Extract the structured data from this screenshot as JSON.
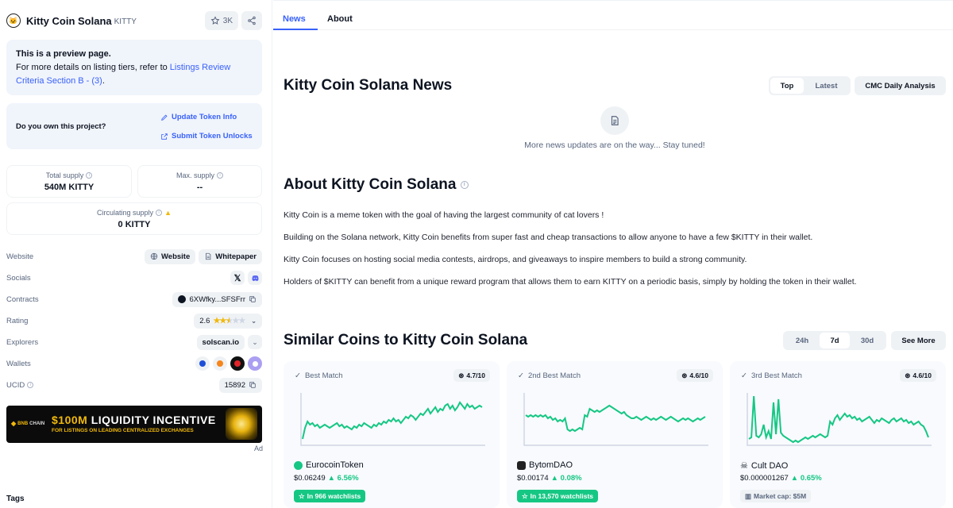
{
  "coin": {
    "name": "Kitty Coin Solana",
    "symbol": "KITTY",
    "star_count": "3K"
  },
  "preview": {
    "title": "This is a preview page.",
    "text": "For more details on listing tiers, refer to ",
    "link": "Listings Review Criteria Section B - (3)",
    "suffix": "."
  },
  "own": {
    "question": "Do you own this project?",
    "update_link": "Update Token Info",
    "unlocks_link": "Submit Token Unlocks"
  },
  "stats": {
    "total_supply_label": "Total supply",
    "total_supply_value": "540M KITTY",
    "max_supply_label": "Max. supply",
    "max_supply_value": "--",
    "circ_supply_label": "Circulating supply",
    "circ_supply_value": "0 KITTY"
  },
  "links": {
    "website_label": "Website",
    "website_btn": "Website",
    "whitepaper_btn": "Whitepaper",
    "socials_label": "Socials",
    "contracts_label": "Contracts",
    "contract_value": "6XWfky...SFSFrr",
    "rating_label": "Rating",
    "rating_value": "2.6",
    "rating_stars": 2.6,
    "explorers_label": "Explorers",
    "explorer_value": "solscan.io",
    "wallets_label": "Wallets",
    "ucid_label": "UCID",
    "ucid_value": "15892"
  },
  "banner": {
    "brand": "BNB",
    "brand_suffix": "CHAIN",
    "headline_amount": "$100M",
    "headline_text": " LIQUIDITY INCENTIVE",
    "subline": "FOR LISTINGS ON LEADING CENTRALIZED EXCHANGES",
    "ad_label": "Ad"
  },
  "tags_label": "Tags",
  "tabs": {
    "news": "News",
    "about": "About"
  },
  "news": {
    "title": "Kitty Coin Solana News",
    "filter_top": "Top",
    "filter_latest": "Latest",
    "analysis_btn": "CMC Daily Analysis",
    "empty": "More news updates are on the way... Stay tuned!"
  },
  "about": {
    "title": "About Kitty Coin Solana",
    "p1": "Kitty Coin is a meme token with the goal of having the largest community of cat lovers !",
    "p2": "Building on the Solana network, Kitty Coin benefits from super fast and cheap transactions to allow anyone to have a few $KITTY in their wallet.",
    "p3": "Kitty Coin focuses on hosting social media contests, airdrops, and giveaways to inspire members to build a strong community.",
    "p4": "Holders of $KITTY can benefit from a unique reward program that allows them to earn KITTY on a periodic basis, simply by holding the token in their wallet."
  },
  "similar": {
    "title": "Similar Coins to Kitty Coin Solana",
    "range_24h": "24h",
    "range_7d": "7d",
    "range_30d": "30d",
    "see_more": "See More",
    "cards": [
      {
        "match": "Best Match",
        "score": "4.7/10",
        "name": "EurocoinToken",
        "price": "$0.06249",
        "change": "6.56%",
        "pill": "In 966 watchlists",
        "logo_color": "#16c784",
        "sparkline": [
          3,
          10,
          14,
          12,
          13,
          11,
          12,
          10,
          11,
          12,
          11,
          10,
          11,
          12,
          13,
          11,
          12,
          10,
          11,
          10,
          9,
          11,
          10,
          12,
          11,
          13,
          12,
          11,
          10,
          12,
          11,
          13,
          12,
          14,
          13,
          15,
          14,
          16,
          14,
          15,
          13,
          15,
          17,
          16,
          18,
          17,
          15,
          17,
          19,
          18,
          20,
          22,
          19,
          21,
          23,
          20,
          22,
          21,
          24,
          25,
          22,
          24,
          21,
          23,
          26,
          24,
          22,
          25,
          23,
          24,
          22,
          23,
          24,
          23
        ]
      },
      {
        "match": "2nd Best Match",
        "score": "4.6/10",
        "name": "BytomDAO",
        "price": "$0.00174",
        "change": "0.08%",
        "pill": "In 13,570 watchlists",
        "logo_color": "#222222",
        "sparkline": [
          18,
          17,
          18,
          17,
          18,
          17,
          18,
          17,
          18,
          16,
          17,
          15,
          16,
          14,
          15,
          14,
          16,
          9,
          8,
          9,
          8,
          9,
          10,
          9,
          18,
          17,
          22,
          21,
          20,
          21,
          20,
          21,
          22,
          23,
          24,
          23,
          22,
          21,
          20,
          19,
          20,
          18,
          17,
          16,
          16,
          17,
          16,
          15,
          16,
          17,
          16,
          15,
          16,
          15,
          16,
          17,
          16,
          15,
          16,
          17,
          16,
          15,
          14,
          15,
          16,
          15,
          16,
          15,
          14,
          15,
          16,
          15,
          16,
          17
        ]
      },
      {
        "match": "3rd Best Match",
        "score": "4.6/10",
        "name": "Cult DAO",
        "price": "$0.000001267",
        "change": "0.65%",
        "pill": "Market cap: $5M",
        "logo_color": "#888888",
        "sparkline": [
          3,
          4,
          30,
          5,
          4,
          6,
          12,
          4,
          8,
          3,
          26,
          6,
          28,
          7,
          5,
          4,
          3,
          2,
          1,
          2,
          1,
          2,
          3,
          4,
          3,
          4,
          5,
          4,
          5,
          6,
          5,
          4,
          5,
          14,
          12,
          16,
          18,
          15,
          17,
          19,
          17,
          18,
          16,
          17,
          15,
          16,
          14,
          15,
          16,
          17,
          15,
          13,
          15,
          14,
          16,
          15,
          14,
          13,
          15,
          16,
          14,
          15,
          16,
          14,
          15,
          13,
          14,
          12,
          13,
          14,
          12,
          11,
          8,
          4
        ]
      }
    ]
  }
}
